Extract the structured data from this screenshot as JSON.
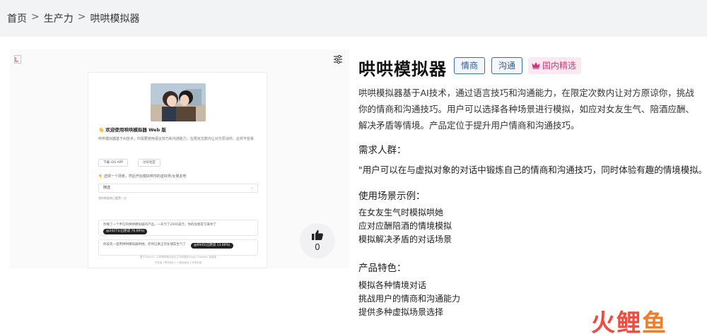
{
  "breadcrumb": {
    "items": [
      "首页",
      "生产力",
      "哄哄模拟器"
    ],
    "separator": ">"
  },
  "preview": {
    "header_title": "👋 欢迎使用哄哄模拟器 Web 版",
    "header_desc": "哄哄模拟器基于AI技术，你需要使用语言技巧和沟通能力，在限定次数内让对方原谅你，这并不容易",
    "buttons": [
      "下载 iOS APP",
      "讨论社区"
    ],
    "prompt": "👇 选择一个场景，然后开始模拟哄你的虚拟男/女朋友吧",
    "select_value": "随选",
    "note": "我的数据每日重置一次",
    "cards": [
      {
        "text": "你做了一个半信的哄哄模拟器的产品，一天亏了2000美元，你的女朋友写来你了",
        "badge": "@24271(已原谅 76.00%)"
      },
      {
        "text": "你说先一直用哄哄模拟器哄她，老师已真正的女朋友生气了",
        "badge": "@6945(已原谅 13.00%)"
      }
    ],
    "footer1": "基于OpenAI，从哔哩哔哩大佬大王中和限制Tongyi Qianwen 免费版",
    "footer2": "开发者 | 联系我们 | 小程序版本 | 分享页面"
  },
  "like": {
    "count": "0"
  },
  "product": {
    "title": "哄哄模拟器",
    "tags": [
      "情商",
      "沟通"
    ],
    "featured_tag": "国内精选",
    "description": "哄哄模拟器基于AI技术，通过语言技巧和沟通能力，在限定次数内让对方原谅你，挑战你的情商和沟通技巧。用户可以选择各种场景进行模拟，如应对女友生气、陪酒应酬、解决矛盾等情境。产品定位于提升用户情商和沟通技巧。",
    "audience_heading": "需求人群：",
    "audience_text": "\"用户可以在与虚拟对象的对话中锻炼自己的情商和沟通技巧，同时体验有趣的情境模拟。\"",
    "scenarios_heading": "使用场景示例：",
    "scenarios": [
      "在女友生气时模拟哄她",
      "应对应酬陪酒的情境模拟",
      "模拟解决矛盾的对话场景"
    ],
    "features_heading": "产品特色：",
    "features": [
      "模拟各种情境对话",
      "挑战用户的情商和沟通能力",
      "提供多种虚拟场景选择"
    ]
  },
  "watermark": {
    "chars": [
      "火",
      "鲤",
      "鱼"
    ]
  },
  "colors": {
    "tag_border": "#3a6ea5",
    "featured_bg": "#fce8f1",
    "featured_text": "#d6337a",
    "watermark_red": "#ef4b3f",
    "watermark_orange": "#f07d2a"
  },
  "icons": [
    "broken-image-icon",
    "filter-icon",
    "thumbs-up-icon",
    "crown-icon",
    "chevron-down-icon"
  ]
}
